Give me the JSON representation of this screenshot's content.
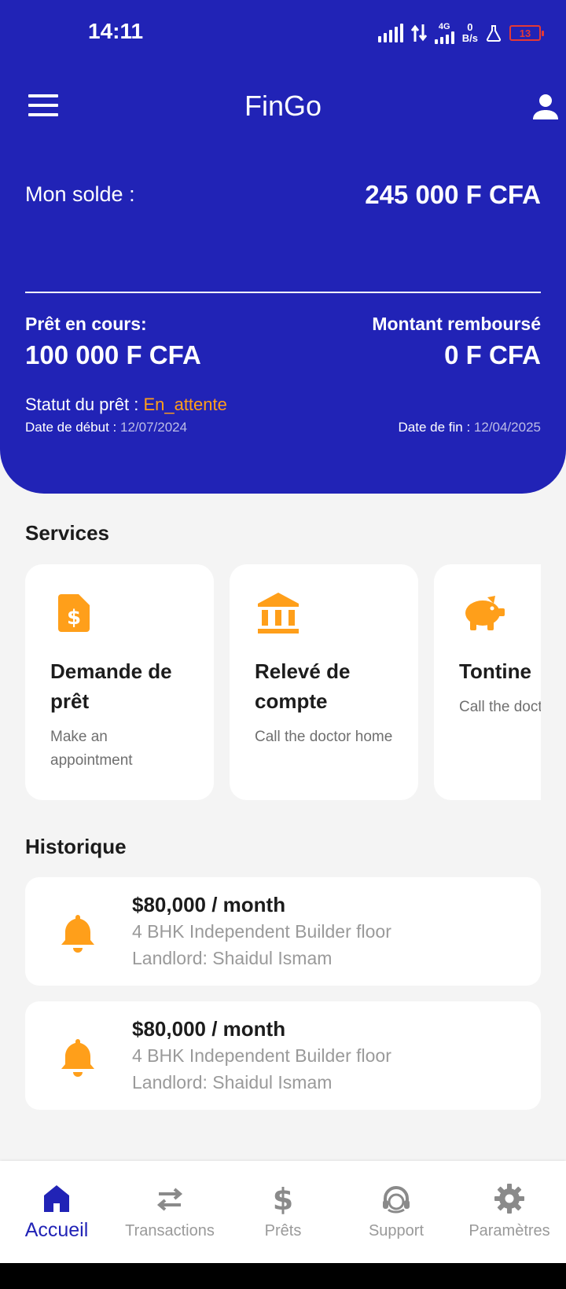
{
  "status_bar": {
    "time": "14:11",
    "network": "4G",
    "speed_value": "0",
    "speed_unit": "B/s",
    "battery": "13"
  },
  "appbar": {
    "title": "FinGo"
  },
  "balance": {
    "label": "Mon solde :",
    "value": "245 000 F CFA"
  },
  "loan": {
    "current_label": "Prêt en cours:",
    "current_value": "100 000 F CFA",
    "repaid_label": "Montant remboursé",
    "repaid_value": "0 F CFA",
    "status_label": "Statut du prêt : ",
    "status_value": "En_attente",
    "start_label": "Date de début : ",
    "start_value": "12/07/2024",
    "end_label": "Date de fin : ",
    "end_value": "12/04/2025"
  },
  "services": {
    "title": "Services",
    "items": [
      {
        "icon": "file-dollar-icon",
        "title": "Demande de prêt",
        "desc": "Make an appointment"
      },
      {
        "icon": "bank-icon",
        "title": "Relevé de compte",
        "desc": "Call the doctor home"
      },
      {
        "icon": "piggy-bank-icon",
        "title": "Tontine",
        "desc": "Call the doctor home"
      }
    ]
  },
  "history": {
    "title": "Historique",
    "items": [
      {
        "icon": "bell-icon",
        "title": "$80,000 / month",
        "line1": "4 BHK Independent Builder floor",
        "line2": "Landlord: Shaidul Ismam"
      },
      {
        "icon": "bell-icon",
        "title": "$80,000 / month",
        "line1": "4 BHK Independent Builder floor",
        "line2": "Landlord: Shaidul Ismam"
      }
    ]
  },
  "nav": {
    "items": [
      {
        "icon": "home-icon",
        "label": "Accueil",
        "active": true
      },
      {
        "icon": "swap-icon",
        "label": "Transactions",
        "active": false
      },
      {
        "icon": "dollar-icon",
        "label": "Prêts",
        "active": false
      },
      {
        "icon": "support-icon",
        "label": "Support",
        "active": false
      },
      {
        "icon": "gear-icon",
        "label": "Paramètres",
        "active": false
      }
    ]
  },
  "colors": {
    "primary": "#2123b6",
    "accent": "#ff9f1a",
    "background": "#f4f4f4",
    "muted": "#9a9a9a"
  }
}
